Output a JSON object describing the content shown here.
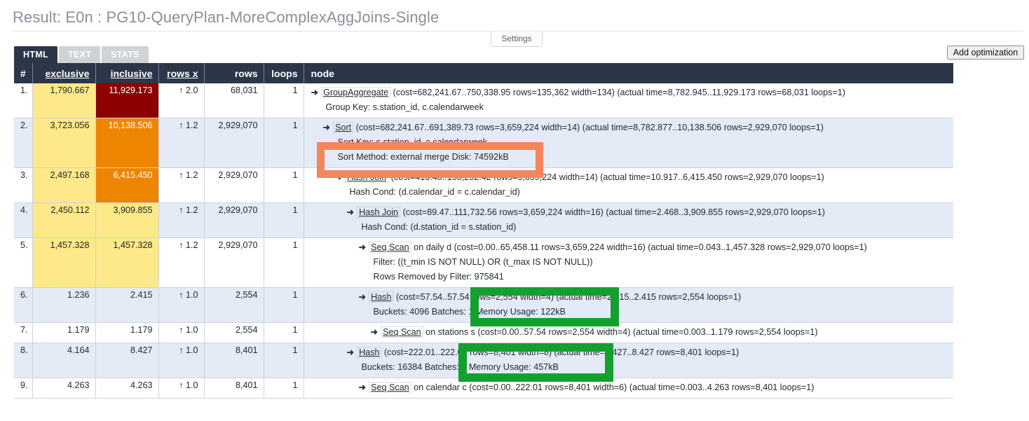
{
  "header": {
    "title": "Result: E0n : PG10-QueryPlan-MoreComplexAggJoins-Single",
    "settings_label": "Settings",
    "add_optimization_label": "Add optimization"
  },
  "tabs": [
    {
      "label": "HTML",
      "active": true
    },
    {
      "label": "TEXT",
      "active": false
    },
    {
      "label": "STATS",
      "active": false
    }
  ],
  "table": {
    "columns": {
      "num": "#",
      "exclusive": "exclusive",
      "inclusive": "inclusive",
      "rows_x": "rows x",
      "rows": "rows",
      "loops": "loops",
      "node": "node"
    },
    "rows": [
      {
        "num": "1.",
        "exclusive": "1,790.667",
        "inclusive": "11,929.173",
        "rows_x": "↑ 2.0",
        "rows": "68,031",
        "loops": "1",
        "node_name": "GroupAggregate",
        "node_rest": "(cost=682,241.67..750,338.95 rows=135,362 width=134) (actual time=8,782.945..11,929.173 rows=68,031 loops=1)",
        "details": [
          "Group Key: s.station_id, c.calendarweek"
        ]
      },
      {
        "num": "2.",
        "exclusive": "3,723.056",
        "inclusive": "10,138.506",
        "rows_x": "↑ 1.2",
        "rows": "2,929,070",
        "loops": "1",
        "node_name": "Sort",
        "node_rest": "(cost=682,241.67..691,389.73 rows=3,659,224 width=14) (actual time=8,782.877..10,138.506 rows=2,929,070 loops=1)",
        "details": [
          "Sort Key: s.station_id, c.calendarweek",
          "Sort Method: external merge Disk: 74592kB"
        ]
      },
      {
        "num": "3.",
        "exclusive": "2,497.168",
        "inclusive": "6,415.450",
        "rows_x": "↑ 1.2",
        "rows": "2,929,070",
        "loops": "1",
        "node_name": "Hash Join",
        "node_rest": "(cost=416.40..158,252.42 rows=3,659,224 width=14) (actual time=10.917..6,415.450 rows=2,929,070 loops=1)",
        "details": [
          "Hash Cond: (d.calendar_id = c.calendar_id)"
        ]
      },
      {
        "num": "4.",
        "exclusive": "2,450.112",
        "inclusive": "3,909.855",
        "rows_x": "↑ 1.2",
        "rows": "2,929,070",
        "loops": "1",
        "node_name": "Hash Join",
        "node_rest": "(cost=89.47..111,732.56 rows=3,659,224 width=16) (actual time=2.468..3,909.855 rows=2,929,070 loops=1)",
        "details": [
          "Hash Cond: (d.station_id = s.station_id)"
        ]
      },
      {
        "num": "5.",
        "exclusive": "1,457.328",
        "inclusive": "1,457.328",
        "rows_x": "↑ 1.2",
        "rows": "2,929,070",
        "loops": "1",
        "node_name": "Seq Scan",
        "node_rest": "on daily d (cost=0.00..65,458.11 rows=3,659,224 width=16) (actual time=0.043..1,457.328 rows=2,929,070 loops=1)",
        "details": [
          "Filter: ((t_min IS NOT NULL) OR (t_max IS NOT NULL))",
          "Rows Removed by Filter: 975841"
        ]
      },
      {
        "num": "6.",
        "exclusive": "1.236",
        "inclusive": "2.415",
        "rows_x": "↑ 1.0",
        "rows": "2,554",
        "loops": "1",
        "node_name": "Hash",
        "node_rest": "(cost=57.54..57.54 rows=2,554 width=4) (actual time=2.415..2.415 rows=2,554 loops=1)",
        "details": [
          "Buckets: 4096 Batches: 1 Memory Usage: 122kB"
        ]
      },
      {
        "num": "7.",
        "exclusive": "1.179",
        "inclusive": "1.179",
        "rows_x": "↑ 1.0",
        "rows": "2,554",
        "loops": "1",
        "node_name": "Seq Scan",
        "node_rest": "on stations s (cost=0.00..57.54 rows=2,554 width=4) (actual time=0.003..1.179 rows=2,554 loops=1)",
        "details": []
      },
      {
        "num": "8.",
        "exclusive": "4.164",
        "inclusive": "8.427",
        "rows_x": "↑ 1.0",
        "rows": "8,401",
        "loops": "1",
        "node_name": "Hash",
        "node_rest": "(cost=222.01..222.01 rows=8,401 width=8) (actual time=8.427..8.427 rows=8,401 loops=1)",
        "details": [
          "Buckets: 16384 Batches: 1 Memory Usage: 457kB"
        ]
      },
      {
        "num": "9.",
        "exclusive": "4.263",
        "inclusive": "4.263",
        "rows_x": "↑ 1.0",
        "rows": "8,401",
        "loops": "1",
        "node_name": "Seq Scan",
        "node_rest": "on calendar c (cost=0.00..222.01 rows=8,401 width=6) (actual time=0.003..4.263 rows=8,401 loops=1)",
        "details": []
      }
    ]
  },
  "annotations": {
    "orange_box_color": "#f4855c",
    "green_box_color": "#14a02e"
  },
  "colors": {
    "header_bg": "#2b3648",
    "heat_yellow": "#fde98a",
    "heat_orange": "#ee8500",
    "heat_darkred": "#8c0000",
    "row_even": "#e4eaf6"
  }
}
